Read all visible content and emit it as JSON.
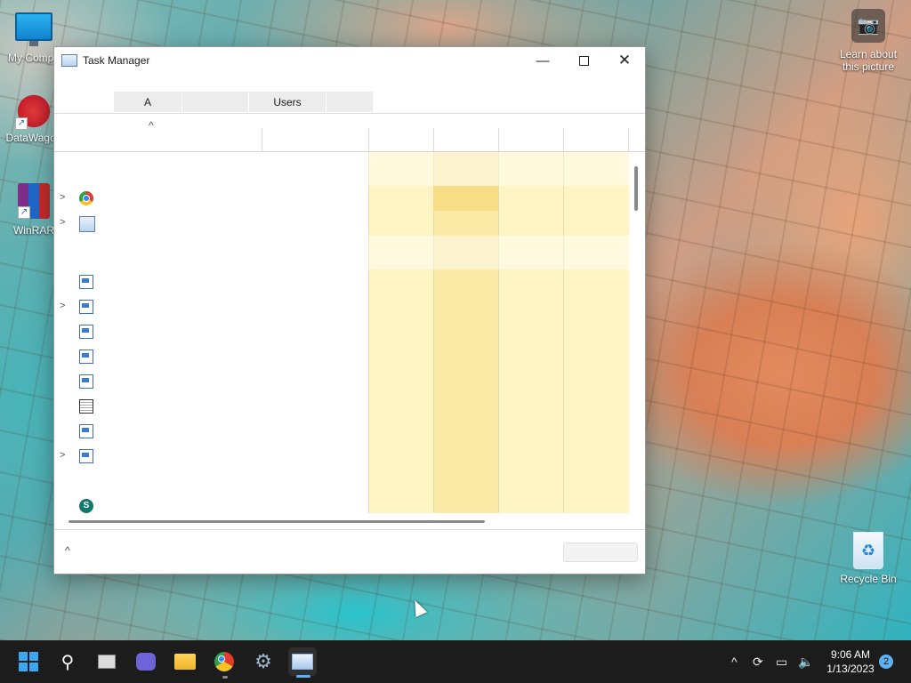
{
  "desktop": {
    "icons": [
      {
        "label": "My Compu"
      },
      {
        "label": "DataWagon"
      },
      {
        "label": "WinRAR"
      }
    ],
    "spotlight_label": "Learn about this picture",
    "recycle_label": "Recycle Bin"
  },
  "window": {
    "title": "Task Manager",
    "tabs": [
      "",
      "A",
      "",
      "Users",
      ""
    ],
    "colors": {
      "cpu_band": "#fff4c4",
      "mem_band": "#fbeaa6",
      "row_highlight": "#f7de86"
    },
    "rows": [
      {
        "expandable": false,
        "icon": "none"
      },
      {
        "expandable": true,
        "icon": "chrome-icon"
      },
      {
        "expandable": true,
        "icon": "task-manager-icon"
      },
      {
        "expandable": false,
        "icon": "none"
      },
      {
        "expandable": false,
        "icon": "window-app-icon"
      },
      {
        "expandable": true,
        "icon": "window-app-icon"
      },
      {
        "expandable": false,
        "icon": "window-app-icon"
      },
      {
        "expandable": false,
        "icon": "window-app-icon"
      },
      {
        "expandable": false,
        "icon": "window-app-icon"
      },
      {
        "expandable": false,
        "icon": "notepad-icon"
      },
      {
        "expandable": false,
        "icon": "window-app-icon"
      },
      {
        "expandable": true,
        "icon": "window-app-icon"
      },
      {
        "expandable": false,
        "icon": "sharepoint-icon"
      }
    ]
  },
  "taskbar": {
    "apps": [
      "start-icon",
      "search-icon",
      "task-view-icon",
      "teams-chat-icon",
      "file-explorer-icon",
      "chrome-icon",
      "settings-icon",
      "task-manager-icon"
    ],
    "time": "9:06 AM",
    "date": "1/13/2023",
    "notification_count": "2"
  }
}
